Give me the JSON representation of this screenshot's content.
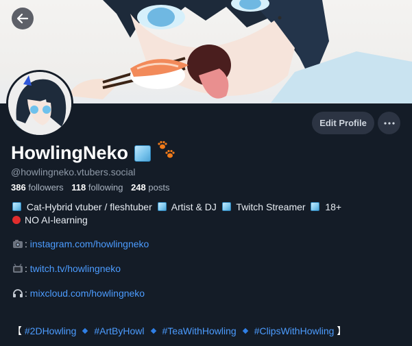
{
  "profile": {
    "display_name": "HowlingNeko",
    "handle": "@howlingneko.vtubers.social",
    "stats": {
      "followers_count": "386",
      "followers_label": "followers",
      "following_count": "118",
      "following_label": "following",
      "posts_count": "248",
      "posts_label": "posts"
    },
    "edit_label": "Edit Profile"
  },
  "bio": {
    "line1": [
      "Cat-Hybrid vtuber / fleshtuber",
      "Artist & DJ",
      "Twitch Streamer",
      "18+"
    ],
    "line2": "NO AI-learning",
    "links": [
      {
        "icon": "camera-icon",
        "url": "instagram.com/howlingneko"
      },
      {
        "icon": "tv-icon",
        "url": "twitch.tv/howlingneko"
      },
      {
        "icon": "headphones-icon",
        "url": "mixcloud.com/howlingneko"
      }
    ],
    "tags": [
      "#2DHowling",
      "#ArtByHowl",
      "#TeaWithHowling",
      "#ClipsWithHowling"
    ],
    "bracket_open": "【",
    "bracket_close": "】"
  },
  "colors": {
    "background": "#141c27",
    "link": "#4c9cff",
    "button_bg": "#2c3443"
  }
}
